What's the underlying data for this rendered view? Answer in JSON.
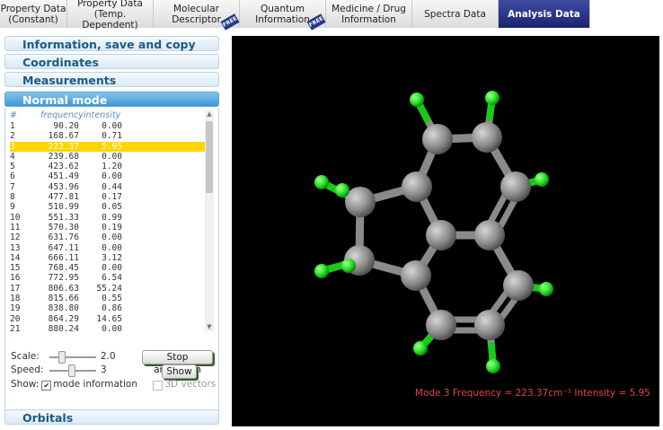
{
  "tabs": [
    {
      "label": "Property Data\n(Constant)",
      "free": false,
      "active": false
    },
    {
      "label": "Property Data\n(Temp. Dependent)",
      "free": false,
      "active": false
    },
    {
      "label": "Molecular\nDescriptor",
      "free": true,
      "active": false
    },
    {
      "label": "Quantum\nInformation",
      "free": true,
      "active": false
    },
    {
      "label": "Medicine / Drug\nInformation",
      "free": false,
      "active": false
    },
    {
      "label": "Spectra Data",
      "free": false,
      "active": false
    },
    {
      "label": "Analysis Data",
      "free": false,
      "active": true
    }
  ],
  "free_badge": "FREE",
  "accordion": {
    "info": "Information, save and copy",
    "coords": "Coordinates",
    "measure": "Measurements",
    "normal": "Normal mode",
    "orbitals": "Orbitals"
  },
  "table": {
    "headers": {
      "num": "#",
      "freq": "frequency",
      "inten": "intensity"
    },
    "rows": [
      [
        "1",
        "90.20",
        "0.00"
      ],
      [
        "2",
        "168.67",
        "0.71"
      ],
      [
        "3",
        "223.37",
        "5.95"
      ],
      [
        "4",
        "239.68",
        "0.00"
      ],
      [
        "5",
        "423.62",
        "1.20"
      ],
      [
        "6",
        "451.49",
        "0.00"
      ],
      [
        "7",
        "453.96",
        "0.44"
      ],
      [
        "8",
        "477.81",
        "0.17"
      ],
      [
        "9",
        "510.99",
        "0.05"
      ],
      [
        "10",
        "551.33",
        "0.99"
      ],
      [
        "11",
        "570.30",
        "0.19"
      ],
      [
        "12",
        "631.76",
        "0.00"
      ],
      [
        "13",
        "647.11",
        "0.00"
      ],
      [
        "14",
        "666.11",
        "3.12"
      ],
      [
        "15",
        "768.45",
        "0.00"
      ],
      [
        "16",
        "772.95",
        "6.54"
      ],
      [
        "17",
        "806.63",
        "55.24"
      ],
      [
        "18",
        "815.66",
        "0.55"
      ],
      [
        "19",
        "838.80",
        "0.86"
      ],
      [
        "20",
        "864.29",
        "14.65"
      ],
      [
        "21",
        "880.24",
        "0.00"
      ]
    ],
    "selected_index": 2
  },
  "controls": {
    "scale_label": "Scale:",
    "scale_value": "2.0",
    "speed_label": "Speed:",
    "speed_value": "3",
    "show_label": "Show:",
    "mode_info_label": "mode information",
    "mode_info_checked": true,
    "vectors_label": "3D vectors",
    "vectors_checked": false,
    "stop_button": "Stop animation",
    "show_button": "Show"
  },
  "viewer": {
    "mode_text": "Mode 3  Frequency = 223.37cm⁻¹  Intensity = 5.95"
  },
  "colors": {
    "carbon": "#8c8c8c",
    "hydrogen": "#1ee01e",
    "accent_text": "#e0414f"
  }
}
